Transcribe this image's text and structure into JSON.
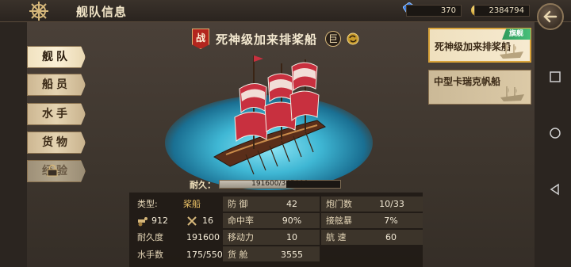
{
  "header": {
    "title": "舰队信息",
    "gems": "370",
    "gold": "2384794"
  },
  "tabs": [
    {
      "label": "舰队",
      "active": true
    },
    {
      "label": "船员",
      "active": false
    },
    {
      "label": "水手",
      "active": false
    },
    {
      "label": "货物",
      "active": false
    },
    {
      "label": "经验",
      "active": false,
      "locked": true
    }
  ],
  "ship": {
    "battle_badge": "战",
    "name": "死神级加来排桨船",
    "size_badge": "巨",
    "durability_label": "耐久：",
    "durability_text": "191600/345000",
    "durability_fraction": 0.555
  },
  "stats": {
    "type_label": "类型:",
    "type_value": "桨船",
    "icon1_value": "912",
    "icon2_value": "16",
    "durability_label": "耐久度",
    "durability_value": "191600",
    "sailors_label": "水手数",
    "sailors_value": "175/550",
    "defense_label": "防 御",
    "defense_value": "42",
    "accuracy_label": "命中率",
    "accuracy_value": "90%",
    "mobility_label": "移动力",
    "mobility_value": "10",
    "cargo_label": "货 舱",
    "cargo_value": "3555",
    "cannon_label": "炮门数",
    "cannon_value": "10/33",
    "boarding_label": "接舷暴",
    "boarding_value": "7%",
    "speed_label": "航 速",
    "speed_value": "60"
  },
  "fleet_list": [
    {
      "name": "死神级加来排桨船",
      "flag": "旗舰"
    },
    {
      "name": "中型卡瑞克帆船",
      "flag": ""
    }
  ],
  "colors": {
    "accent_gold": "#d9a33a",
    "war_red": "#b3261e",
    "flag_green": "#48c07a",
    "sea_blue": "#3fb7d4"
  }
}
